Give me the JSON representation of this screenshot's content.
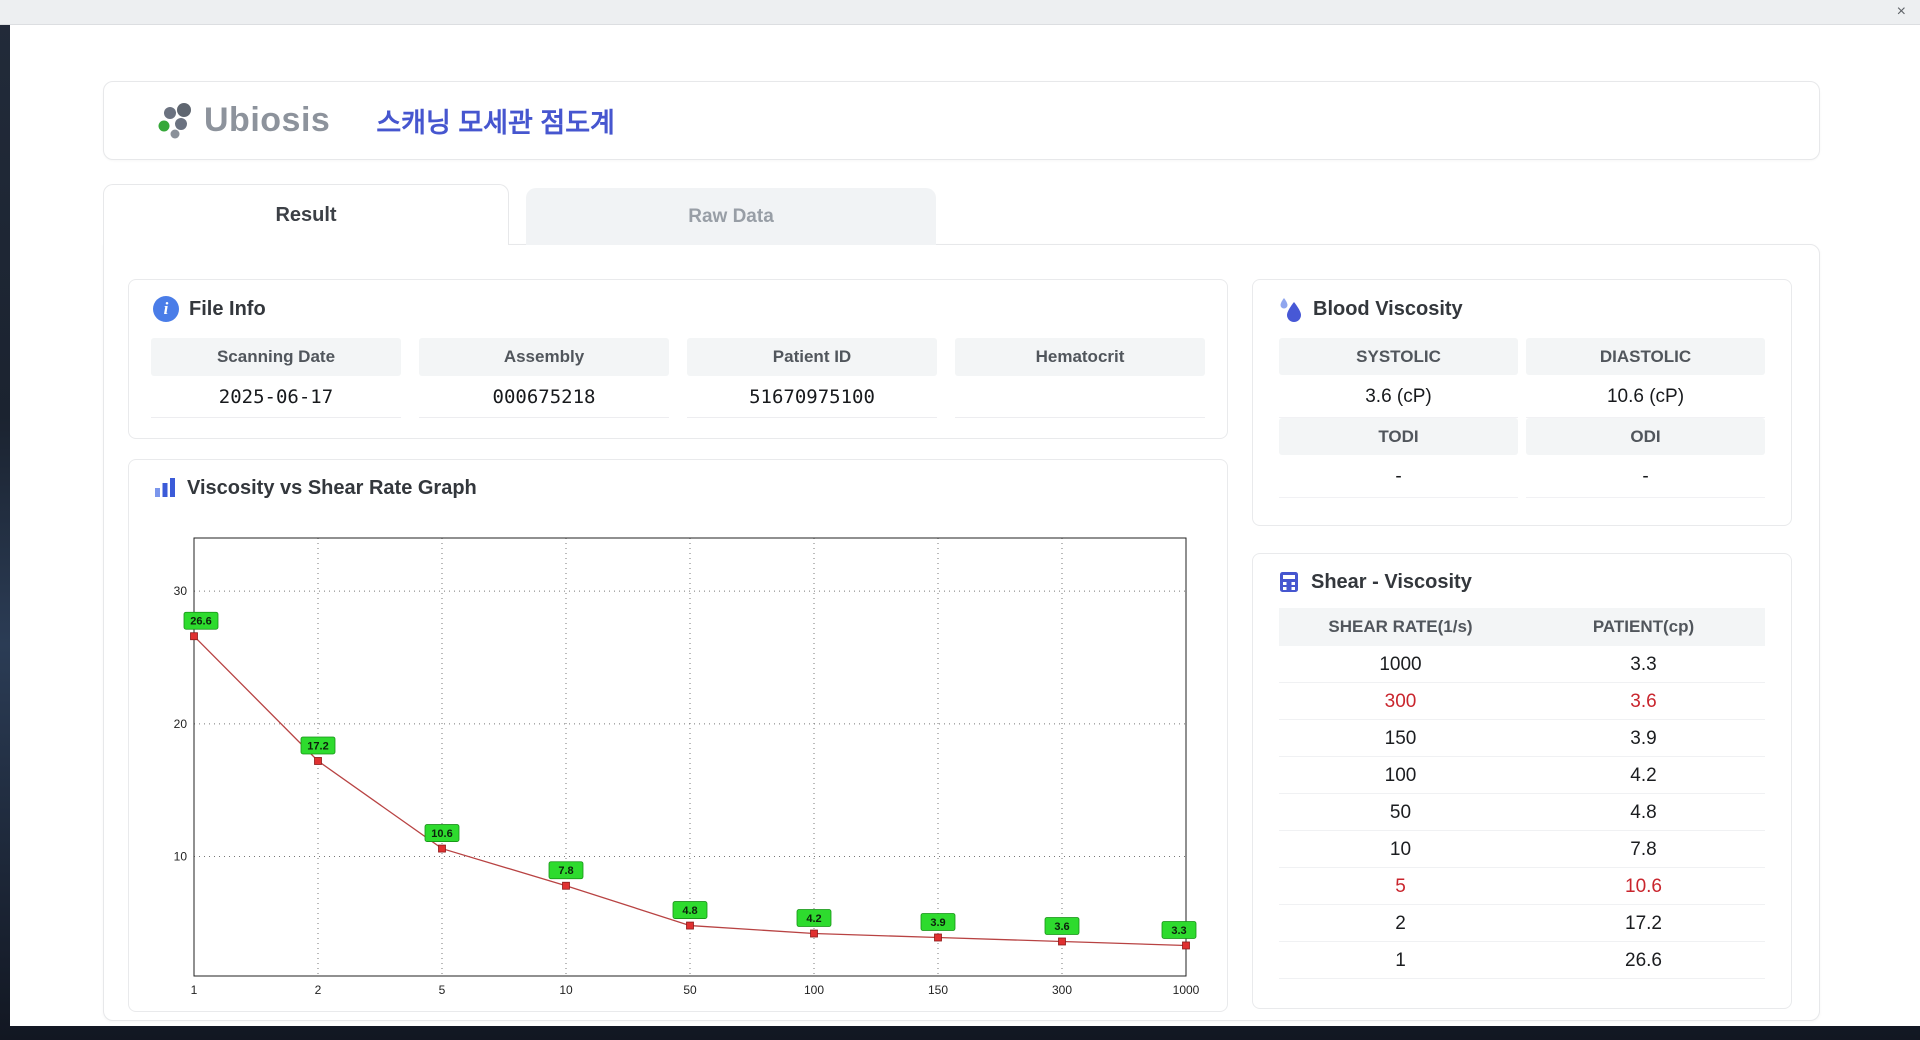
{
  "window": {
    "close_label": "×"
  },
  "header": {
    "logo_text": "Ubiosis",
    "title": "스캐닝 모세관 점도계"
  },
  "tabs": [
    {
      "label": "Result",
      "active": true
    },
    {
      "label": "Raw Data",
      "active": false
    }
  ],
  "file_info": {
    "title": "File Info",
    "fields": [
      {
        "label": "Scanning Date",
        "value": "2025-06-17"
      },
      {
        "label": "Assembly",
        "value": "000675218"
      },
      {
        "label": "Patient ID",
        "value": "51670975100"
      },
      {
        "label": "Hematocrit",
        "value": ""
      }
    ]
  },
  "blood_viscosity": {
    "title": "Blood Viscosity",
    "row1_labels": [
      "SYSTOLIC",
      "DIASTOLIC"
    ],
    "row1_values": [
      "3.6 (cP)",
      "10.6 (cP)"
    ],
    "row2_labels": [
      "TODI",
      "ODI"
    ],
    "row2_values": [
      "-",
      "-"
    ]
  },
  "graph": {
    "title": "Viscosity vs Shear Rate Graph"
  },
  "chart_data": {
    "type": "line",
    "title": "Viscosity vs Shear Rate Graph",
    "x": [
      1,
      2,
      5,
      10,
      50,
      100,
      150,
      300,
      1000
    ],
    "x_tick_labels": [
      "1",
      "2",
      "5",
      "10",
      "50",
      "100",
      "150",
      "300",
      "1000"
    ],
    "values": [
      26.6,
      17.2,
      10.6,
      7.8,
      4.8,
      4.2,
      3.9,
      3.6,
      3.3
    ],
    "point_labels": [
      "26.6",
      "17.2",
      "10.6",
      "7.8",
      "4.8",
      "4.2",
      "3.9",
      "3.6",
      "3.3"
    ],
    "y_ticks": [
      10,
      20,
      30
    ],
    "ylim": [
      1,
      34
    ],
    "x_scale": "categorical-even",
    "grid": "dotted",
    "legend": "none",
    "xlabel": "",
    "ylabel": "",
    "line_color": "#b84343",
    "marker_color": "#e03030",
    "point_label_bg": "#2edb2e"
  },
  "shear_viscosity": {
    "title": "Shear - Viscosity",
    "columns": [
      "SHEAR RATE(1/s)",
      "PATIENT(cp)"
    ],
    "rows": [
      {
        "shear": "1000",
        "patient": "3.3",
        "highlight": false
      },
      {
        "shear": "300",
        "patient": "3.6",
        "highlight": true
      },
      {
        "shear": "150",
        "patient": "3.9",
        "highlight": false
      },
      {
        "shear": "100",
        "patient": "4.2",
        "highlight": false
      },
      {
        "shear": "50",
        "patient": "4.8",
        "highlight": false
      },
      {
        "shear": "10",
        "patient": "7.8",
        "highlight": false
      },
      {
        "shear": "5",
        "patient": "10.6",
        "highlight": true
      },
      {
        "shear": "2",
        "patient": "17.2",
        "highlight": false
      },
      {
        "shear": "1",
        "patient": "26.6",
        "highlight": false
      }
    ]
  },
  "colors": {
    "accent_blue": "#4656cf",
    "highlight_red": "#c9252d",
    "label_green": "#2edb2e",
    "line_red": "#b84343",
    "marker_red": "#e03030"
  }
}
